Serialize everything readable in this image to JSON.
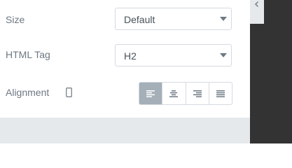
{
  "controls": {
    "size": {
      "label": "Size",
      "value": "Default"
    },
    "html_tag": {
      "label": "HTML Tag",
      "value": "H2"
    },
    "alignment": {
      "label": "Alignment",
      "device_icon": "mobile-device-icon",
      "options": [
        {
          "name": "align-left",
          "icon": "align-left-icon",
          "active": true
        },
        {
          "name": "align-center",
          "icon": "align-center-icon",
          "active": false
        },
        {
          "name": "align-right",
          "icon": "align-right-icon",
          "active": false
        },
        {
          "name": "align-justify",
          "icon": "align-justify-icon",
          "active": false
        }
      ]
    }
  },
  "colors": {
    "label_text": "#6d7882",
    "select_border": "#d5dadf",
    "active_button": "#a4afb7",
    "panel_footer": "#e6e9ec",
    "preview_dark": "#333333"
  }
}
